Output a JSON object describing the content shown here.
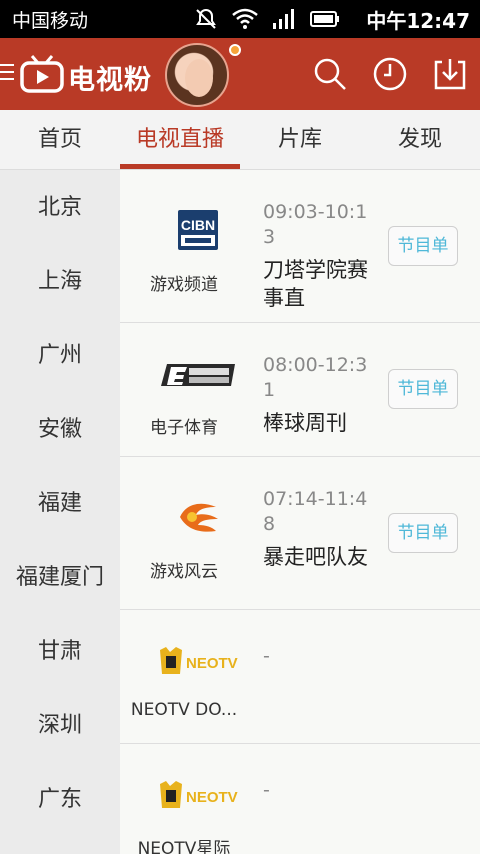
{
  "status_bar": {
    "carrier": "中国移动",
    "time": "中午12:47"
  },
  "app": {
    "name": "电视粉"
  },
  "tabs": [
    {
      "label": "首页",
      "active": false
    },
    {
      "label": "电视直播",
      "active": true
    },
    {
      "label": "片库",
      "active": false
    },
    {
      "label": "发现",
      "active": false
    }
  ],
  "cities": [
    "北京",
    "上海",
    "广州",
    "安徽",
    "福建",
    "福建厦门",
    "甘肃",
    "深圳",
    "广东"
  ],
  "channels": [
    {
      "name": "游戏频道",
      "logo": "cibn-logo",
      "time": "09:03-10:13",
      "program": "刀塔学院赛事直",
      "button": "节目单"
    },
    {
      "name": "电子体育",
      "logo": "esports-logo",
      "time": "08:00-12:31",
      "program": "棒球周刊",
      "button": "节目单"
    },
    {
      "name": "游戏风云",
      "logo": "gamefy-logo",
      "time": "07:14-11:48",
      "program": "暴走吧队友",
      "button": "节目单"
    },
    {
      "name": "NEOTV DO...",
      "logo": "neotv-logo",
      "time": "-",
      "program": "",
      "button": ""
    },
    {
      "name": "NEOTV星际",
      "logo": "neotv-logo",
      "time": "-",
      "program": "",
      "button": ""
    }
  ],
  "colors": {
    "brand": "#b93a26",
    "accent_text": "#4fb8d8",
    "badge": "#f6a43a"
  }
}
